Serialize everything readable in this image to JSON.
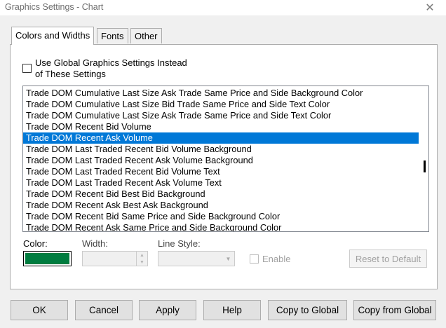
{
  "window": {
    "title": "Graphics Settings  - Chart",
    "close_glyph": "✕"
  },
  "tabs": [
    {
      "label": "Colors and Widths",
      "active": true
    },
    {
      "label": "Fonts",
      "active": false
    },
    {
      "label": "Other",
      "active": false
    }
  ],
  "global_settings": {
    "checked": false,
    "label_line1": "Use Global Graphics Settings Instead",
    "label_line2": "of These Settings"
  },
  "list": {
    "items": [
      "Trade DOM Cumulative Last Size Ask Trade Same Price and Side Background Color",
      "Trade DOM Cumulative Last Size Bid Trade Same Price and Side Text Color",
      "Trade DOM Cumulative Last Size Ask Trade Same Price and Side Text Color",
      "Trade DOM Recent Bid Volume",
      "Trade DOM Recent Ask Volume",
      "Trade DOM Last Traded Recent Bid Volume Background",
      "Trade DOM Last Traded Recent Ask Volume Background",
      "Trade DOM Last Traded Recent Bid Volume Text",
      "Trade DOM Last Traded Recent Ask Volume Text",
      "Trade DOM Recent Bid Best Bid Background",
      "Trade DOM Recent Ask Best Ask Background",
      "Trade DOM Recent Bid Same Price and Side Background Color",
      "Trade DOM Recent Ask Same Price and Side Background Color"
    ],
    "selected_index": 4
  },
  "controls": {
    "color_label": "Color:",
    "color_value": "#007c3f",
    "width_label": "Width:",
    "width_value": "",
    "line_style_label": "Line Style:",
    "line_style_value": "",
    "enable_label": "Enable",
    "reset_label": "Reset to Default"
  },
  "buttons": {
    "ok": "OK",
    "cancel": "Cancel",
    "apply": "Apply",
    "help": "Help",
    "copy_to_global": "Copy to Global",
    "copy_from_global": "Copy from Global"
  },
  "colors": {
    "selection": "#0078d7",
    "swatch": "#007c3f"
  }
}
